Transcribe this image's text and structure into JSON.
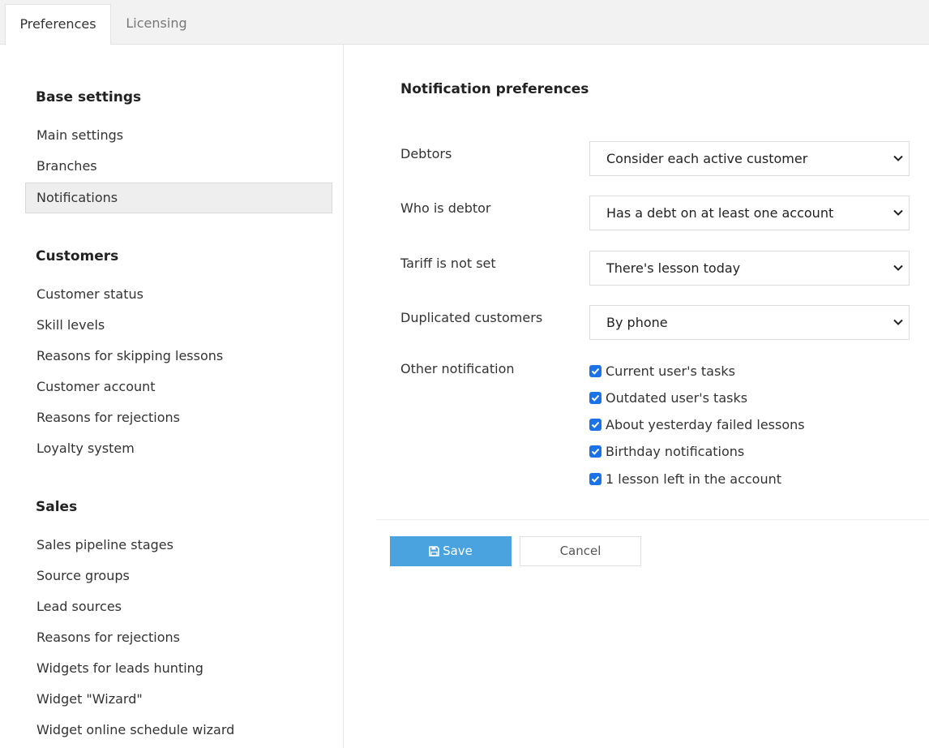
{
  "tabs": [
    {
      "label": "Preferences",
      "active": true
    },
    {
      "label": "Licensing",
      "active": false
    }
  ],
  "sidebar": {
    "sections": [
      {
        "title": "Base settings",
        "items": [
          "Main settings",
          "Branches",
          "Notifications"
        ]
      },
      {
        "title": "Customers",
        "items": [
          "Customer status",
          "Skill levels",
          "Reasons for skipping lessons",
          "Customer account",
          "Reasons for rejections",
          "Loyalty system"
        ]
      },
      {
        "title": "Sales",
        "items": [
          "Sales pipeline stages",
          "Source groups",
          "Lead sources",
          "Reasons for rejections",
          "Widgets for leads hunting",
          "Widget \"Wizard\"",
          "Widget online schedule wizard"
        ]
      }
    ],
    "active_item": "Notifications"
  },
  "main": {
    "title": "Notification preferences",
    "rows": [
      {
        "label": "Debtors",
        "value": "Consider each active customer"
      },
      {
        "label": "Who is debtor",
        "value": "Has a debt on at least one account"
      },
      {
        "label": "Tariff is not set",
        "value": "There's lesson today"
      },
      {
        "label": "Duplicated customers",
        "value": "By phone"
      }
    ],
    "other_label": "Other notification",
    "checkboxes": [
      {
        "label": "Current user's tasks",
        "checked": true
      },
      {
        "label": "Outdated user's tasks",
        "checked": true
      },
      {
        "label": "About yesterday failed lessons",
        "checked": true
      },
      {
        "label": "Birthday notifications",
        "checked": true
      },
      {
        "label": "1 lesson left in the account",
        "checked": true
      }
    ]
  },
  "actions": {
    "save_label": "Save",
    "cancel_label": "Cancel",
    "save_icon": "floppy-disk-icon"
  },
  "colors": {
    "primary": "#4aa3df",
    "checkbox": "#1a73e8",
    "active_nav_bg": "#eeeeee"
  }
}
